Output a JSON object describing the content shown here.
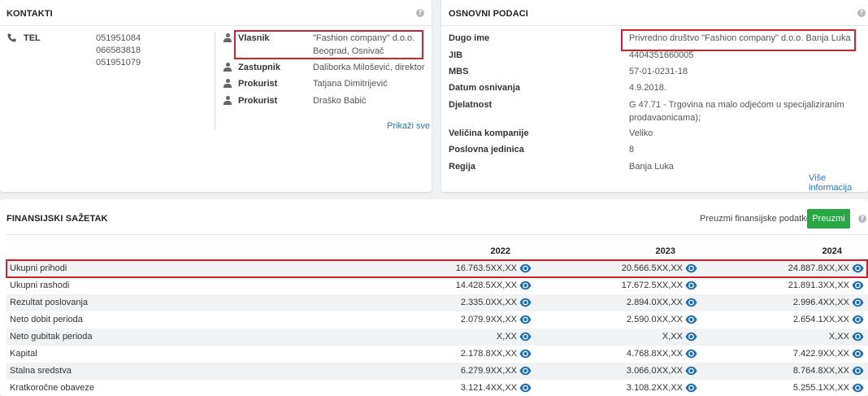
{
  "contacts": {
    "title": "KONTAKTI",
    "tel_label": "TEL",
    "tel_values": [
      "051951084",
      "066583818",
      "051951079"
    ],
    "roles": [
      {
        "role": "Vlasnik",
        "name": "\"Fashion company\" d.o.o. Beograd, Osnivač"
      },
      {
        "role": "Zastupnik",
        "name": "Daliborka Milošević, direktor"
      },
      {
        "role": "Prokurist",
        "name": "Tatjana Dimitrijević"
      },
      {
        "role": "Prokurist",
        "name": "Draško Babić"
      }
    ],
    "show_all": "Prikaži sve"
  },
  "basic": {
    "title": "OSNOVNI PODACI",
    "fields": [
      {
        "label": "Dugo ime",
        "value": "Privredno društvo \"Fashion company\" d.o.o. Banja Luka"
      },
      {
        "label": "JIB",
        "value": "4404351660005"
      },
      {
        "label": "MBS",
        "value": "57-01-0231-18"
      },
      {
        "label": "Datum osnivanja",
        "value": "4.9.2018."
      },
      {
        "label": "Djelatnost",
        "value": "G 47.71 - Trgovina na malo odjećom u specijaliziranim prodavaonicama);"
      },
      {
        "label": "Veličina kompanije",
        "value": "Veliko"
      },
      {
        "label": "Poslovna jedinica",
        "value": "8"
      },
      {
        "label": "Regija",
        "value": "Banja Luka"
      }
    ],
    "more_info": "Više informacija"
  },
  "finance": {
    "title": "FINANSIJSKI SAŽETAK",
    "download_label": "Preuzmi finansijske podatke",
    "download_button": "Preuzmi",
    "years": [
      "2022",
      "2023",
      "2024"
    ],
    "rows": [
      {
        "label": "Ukupni prihodi",
        "values": [
          "16.763.5XX,XX",
          "20.566.5XX,XX",
          "24.887.8XX,XX"
        ]
      },
      {
        "label": "Ukupni rashodi",
        "values": [
          "14.428.5XX,XX",
          "17.672.5XX,XX",
          "21.891.3XX,XX"
        ]
      },
      {
        "label": "Rezultat poslovanja",
        "values": [
          "2.335.0XX,XX",
          "2.894.0XX,XX",
          "2.996.4XX,XX"
        ]
      },
      {
        "label": "Neto dobit perioda",
        "values": [
          "2.079.9XX,XX",
          "2.590.0XX,XX",
          "2.654.1XX,XX"
        ]
      },
      {
        "label": "Neto gubitak perioda",
        "values": [
          "X,XX",
          "X,XX",
          "X,XX"
        ]
      },
      {
        "label": "Kapital",
        "values": [
          "2.178.8XX,XX",
          "4.768.8XX,XX",
          "7.422.9XX,XX"
        ]
      },
      {
        "label": "Stalna sredstva",
        "values": [
          "6.279.9XX,XX",
          "3.066.0XX,XX",
          "8.764.8XX,XX"
        ]
      },
      {
        "label": "Kratkoročne obaveze",
        "values": [
          "3.121.4XX,XX",
          "3.108.2XX,XX",
          "5.255.1XX,XX"
        ]
      }
    ]
  },
  "colors": {
    "highlight": "#d0202a",
    "link": "#2a79b8",
    "button": "#27a844",
    "eye": "#1e6fb0"
  },
  "icons": {
    "phone": "phone-icon",
    "person": "person-icon",
    "eye": "eye-icon",
    "help": "question-circle-icon"
  }
}
